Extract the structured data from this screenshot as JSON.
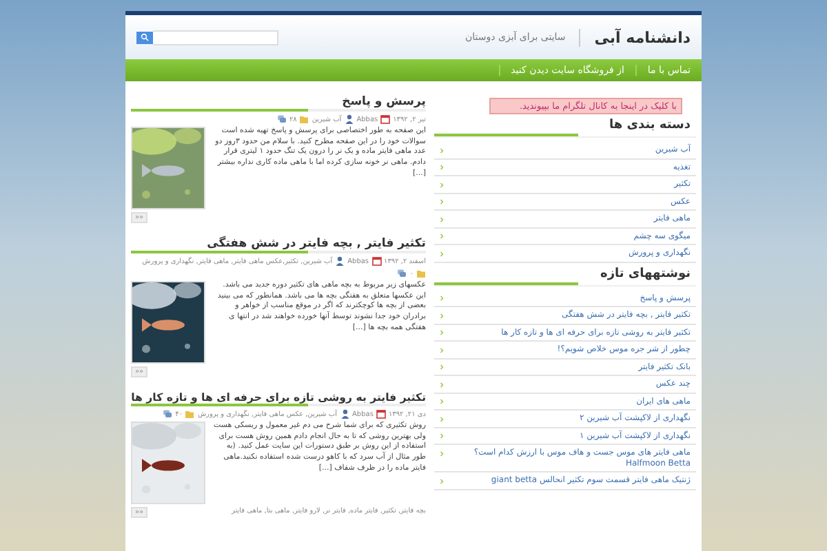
{
  "header": {
    "site_title": "دانشنامه آبی",
    "tagline": "سایتی برای آبزی دوستان"
  },
  "nav": [
    {
      "label": "تماس با ما"
    },
    {
      "label": "از فروشگاه سایت دیدن کنید"
    }
  ],
  "posts": [
    {
      "title": "پرسش و پاسخ",
      "date": "تیر ۲, ۱۳۹۲",
      "author": "Abbas",
      "categories": "آب شیرین",
      "comments": "۲۸",
      "excerpt": "این صفحه به طور اختصاصی برای پرسش و پاسخ تهیه شده است سوالات خود را در این صفحه مطرح کنید. با سلام من حدود ۳روز دو عدد ماهی فایتر ماده و یک نر را درون یک تنگ حدود ۱ لیتری قرار دادم. ماهی نر خونه سازی کرده اما با ماهی ماده کاری نداره بیشتر [...]",
      "more": "««"
    },
    {
      "title": "تکثیر فایتر , بچه فایتر در شش هفتگی",
      "date": "اسفند ۲, ۱۳۹۲",
      "author": "Abbas",
      "categories": "آب شیرین, تکثیر,عکس ماهی فایتر, ماهی فایتر, نگهداری و پرورش",
      "comments": "۰",
      "excerpt": "عکسهای زیر مربوط به بچه ماهی های تکثیر دوره جدید می باشد. این عکسها متعلق به هفتگی بچه ها می باشد. همانطور که می بینید بعضی از بچه ها کوچکترند که اگر در موقع مناسب از خواهر و برادران خود جدا نشوند توسط آنها خورده خواهند شد در انتها ی هفتگی همه بچه ها [...]",
      "more": "««"
    },
    {
      "title": "تکثیر فایتر به روشی تازه برای حرفه ای ها و تازه کار ها",
      "date": "دی ۲۱, ۱۳۹۲",
      "author": "Abbas",
      "categories": "آب شیرین, عکس ماهی فایتر, نگهداری و پرورش",
      "comments": "۴۰",
      "excerpt": "روش تکثیری که برای شما شرح می دم غیر معمول و ریسکی هست ولی بهترین روشی که تا به حال انجام دادم همین روش هست برای استفاده از این روش بر طبق دستورات این سایت عمل کنید. (به طور مثال از آب سرد که با کاهو درست شده استفاده نکنید.ماهی فایتر ماده را در ظرف شفاف [...]",
      "more": "««",
      "tags": "بچه فایتر, تکثیر, فایتر ماده, فایتر نر, لارو فایتر, ماهی بتا, ماهی فایتر"
    }
  ],
  "sidebar": {
    "notice": "با کلیک در اینجا به کانال تلگرام ما بپیوندید.",
    "categories": {
      "title": "دسته بندی ها",
      "items": [
        "آب شیرین",
        "تغذیه",
        "تکثیر",
        "عکس",
        "ماهی فایتر",
        "میگوی سه چشم",
        "نگهداری و پرورش"
      ]
    },
    "recent": {
      "title": "نوشتههای تازه",
      "items": [
        "پرسش و پاسخ",
        "تکثیر فایتر , بچه فایتر در شش هفتگی",
        "تکثیر فایتر به روشی تازه برای حرفه ای ها و تازه کار ها",
        "چطور از شر جره موس خلاص شویم؟!",
        "بانک تکثیر فایتر",
        "چند عکس",
        "ماهی های ایران",
        "نگهداری از لاکپشت آب شیرین ۲",
        "نگهداری از لاکپشت آب شیرین ۱",
        "ماهی فایتر های موس جست و هاف موس با ارزش کدام است؟ Halfmoon Betta",
        "ژنتیک ماهی فایتر قسمت سوم تکثیر انحالس giant betta"
      ]
    }
  }
}
